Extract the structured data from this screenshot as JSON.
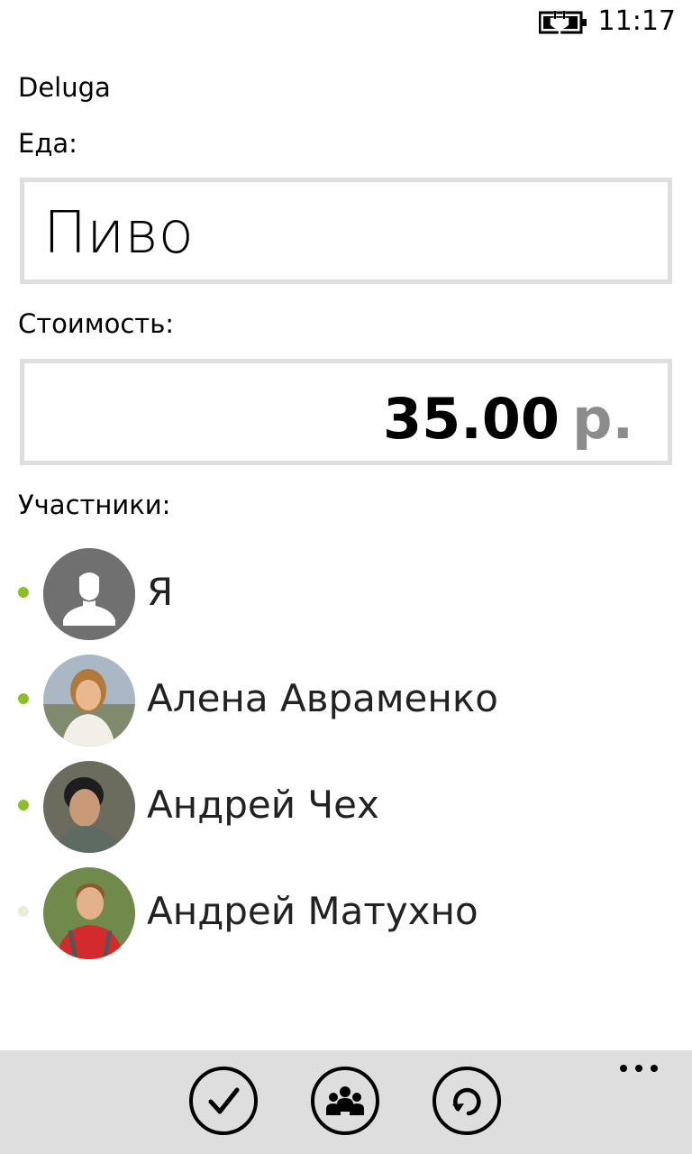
{
  "status_bar": {
    "time": "11:17",
    "battery_icon": "battery-charging-icon"
  },
  "app": {
    "title": "Deluga"
  },
  "form": {
    "food_label": "Еда:",
    "food_value": "Пиво",
    "cost_label": "Стоимость:",
    "cost_amount": "35.00",
    "cost_currency": "р.",
    "members_label": "Участники:"
  },
  "participants": [
    {
      "name": "Я",
      "selected": true,
      "avatar": "default-person-icon"
    },
    {
      "name": "Алена Авраменко",
      "selected": true,
      "avatar": "photo-avatar"
    },
    {
      "name": "Андрей Чех",
      "selected": true,
      "avatar": "photo-avatar"
    },
    {
      "name": "Андрей Матухно",
      "selected": false,
      "avatar": "photo-avatar"
    }
  ],
  "app_bar": {
    "buttons": [
      "check-icon",
      "group-icon",
      "refresh-icon"
    ],
    "more_icon": "ellipsis-icon"
  },
  "colors": {
    "accent_dot": "#8cbf26",
    "accent_dot_inactive": "#e6f0d3",
    "field_border": "#dedede",
    "app_bar_bg": "#dedede",
    "currency": "#8c8c8c"
  }
}
